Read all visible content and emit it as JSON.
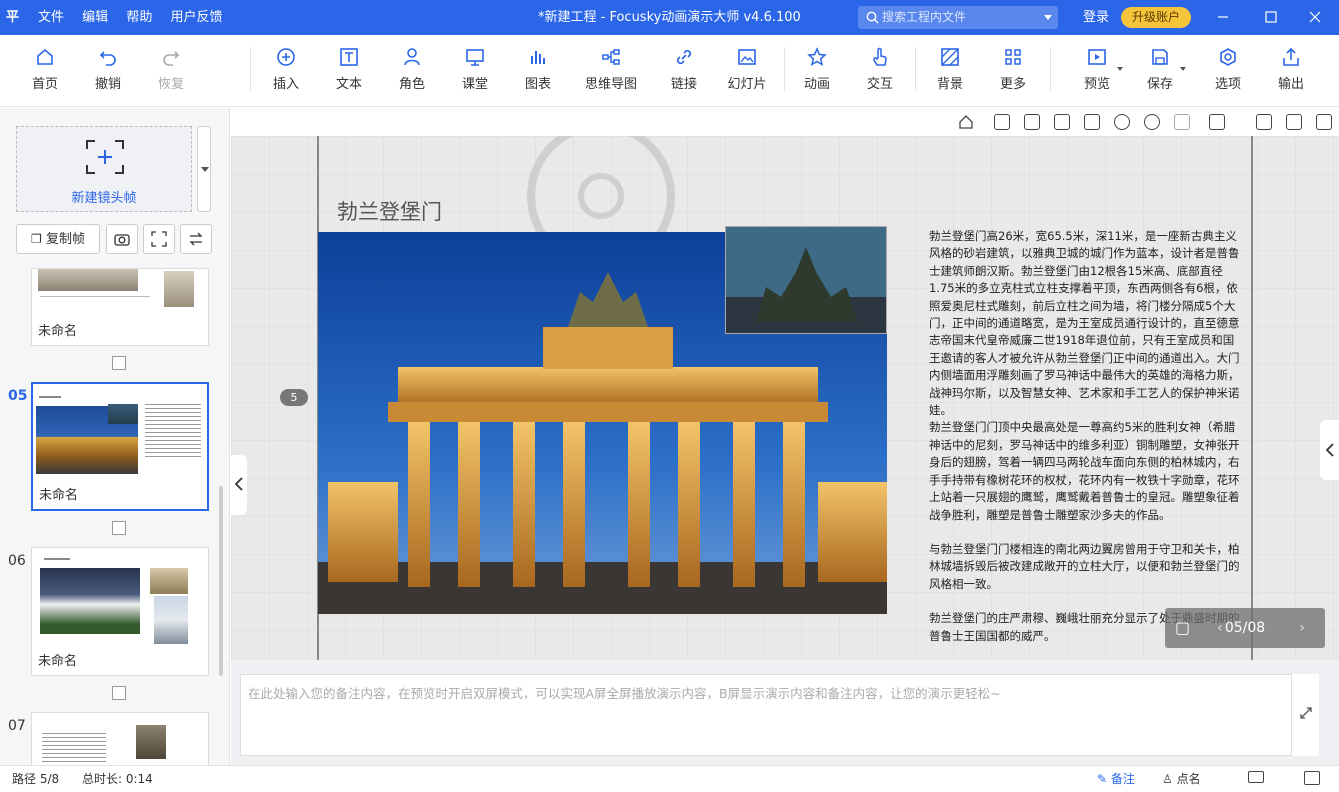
{
  "titlebar": {
    "logo": "平",
    "menu": [
      "文件",
      "编辑",
      "帮助",
      "用户反馈"
    ],
    "window_title": "*新建工程 - Focusky动画演示大师  v4.6.100",
    "search_placeholder": "搜索工程内文件",
    "login": "登录",
    "upgrade": "升级账户"
  },
  "toolbar": {
    "home": "首页",
    "undo": "撤销",
    "redo": "恢复",
    "insert": "插入",
    "text": "文本",
    "role": "角色",
    "classroom": "课堂",
    "chart": "图表",
    "mindmap": "思维导图",
    "link": "链接",
    "slideshow": "幻灯片",
    "animation": "动画",
    "interaction": "交互",
    "background": "背景",
    "more": "更多",
    "preview": "预览",
    "save": "保存",
    "options": "选项",
    "output": "输出"
  },
  "sidebar": {
    "new_frame": "新建镜头帧",
    "copy_frame": "复制帧",
    "slides": [
      {
        "num": "",
        "name": "未命名",
        "selected": false
      },
      {
        "num": "05",
        "name": "未命名",
        "selected": true
      },
      {
        "num": "06",
        "name": "未命名",
        "selected": false
      },
      {
        "num": "07",
        "name": "",
        "selected": false
      }
    ]
  },
  "canvas": {
    "slide_title": "勃兰登堡门",
    "path_badge": "5",
    "pager": "05/08",
    "body": [
      "勃兰登堡门高26米，宽65.5米，深11米，是一座新古典主义风格的砂岩建筑，以雅典卫城的城门作为蓝本，设计者是普鲁士建筑师朗汉斯。勃兰登堡门由12根各15米高、底部直径1.75米的多立克柱式立柱支撑着平顶，东西两侧各有6根，依照爱奥尼柱式雕刻，前后立柱之间为墙，将门楼分隔成5个大门，正中间的通道略宽，是为王室成员通行设计的，直至德意志帝国末代皇帝威廉二世1918年退位前，只有王室成员和国王邀请的客人才被允许从勃兰登堡门正中间的通道出入。大门内侧墙面用浮雕刻画了罗马神话中最伟大的英雄的海格力斯，战神玛尔斯，以及智慧女神、艺术家和手工艺人的保护神米诺娃。",
      "勃兰登堡门门顶中央最高处是一尊高约5米的胜利女神（希腊神话中的尼刻，罗马神话中的维多利亚）铜制雕塑，女神张开身后的翅膀，驾着一辆四马两轮战车面向东侧的柏林城内，右手手持带有橡树花环的权杖，花环内有一枚铁十字勋章，花环上站着一只展翅的鹰鹫，鹰鹫戴着普鲁士的皇冠。雕塑象征着战争胜利，雕塑是普鲁士雕塑家沙多夫的作品。",
      "与勃兰登堡门门楼相连的南北两边翼房曾用于守卫和关卡，柏林城墙拆毁后被改建成敞开的立柱大厅，以便和勃兰登堡门的风格相一致。",
      "勃兰登堡门的庄严肃穆、巍峨壮丽充分显示了处于鼎盛时期的普鲁士王国国都的威严。"
    ]
  },
  "notes": {
    "placeholder": "在此处输入您的备注内容，在预览时开启双屏模式，可以实现A屏全屏播放演示内容，B屏显示演示内容和备注内容，让您的演示更轻松~"
  },
  "status": {
    "path": "路径 5/8",
    "duration": "总时长: 0:14",
    "notes": "备注",
    "rollcall": "点名"
  },
  "colors": {
    "accent": "#2b66e8",
    "upgrade": "#f5c43b"
  }
}
